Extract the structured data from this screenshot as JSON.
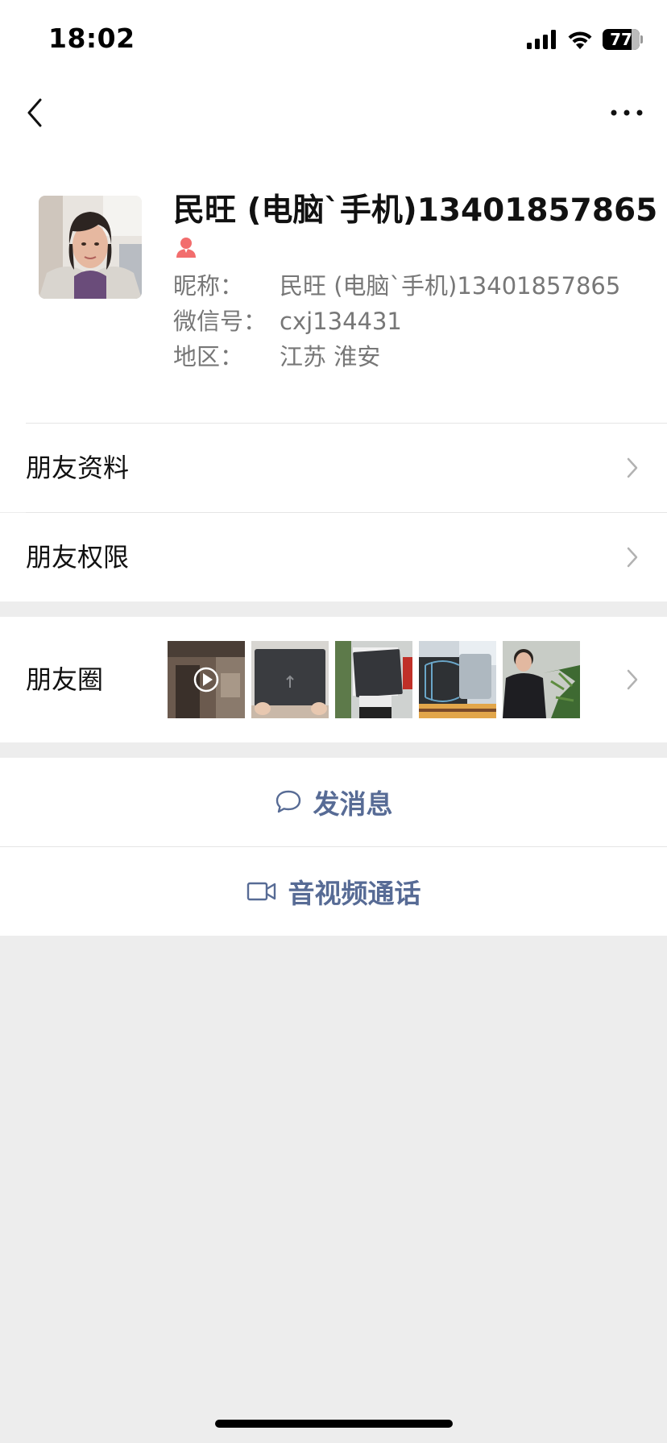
{
  "status_bar": {
    "time": "18:02",
    "battery_level": "77"
  },
  "profile": {
    "display_name": "民旺 (电脑`手机)13401857865",
    "gender": "female-icon",
    "nickname_label": "昵称：",
    "nickname_value": "民旺 (电脑`手机)13401857865",
    "wechat_id_label": "微信号：",
    "wechat_id_value": "cxj134431",
    "region_label": "地区：",
    "region_value": "江苏 淮安"
  },
  "menu": {
    "friend_info_label": "朋友资料",
    "friend_permission_label": "朋友权限",
    "moments_label": "朋友圈"
  },
  "actions": {
    "send_message_label": "发消息",
    "av_call_label": "音视频通话"
  },
  "colors": {
    "link": "#576b95",
    "background": "#ededed",
    "gender_female": "#f26d6d"
  }
}
